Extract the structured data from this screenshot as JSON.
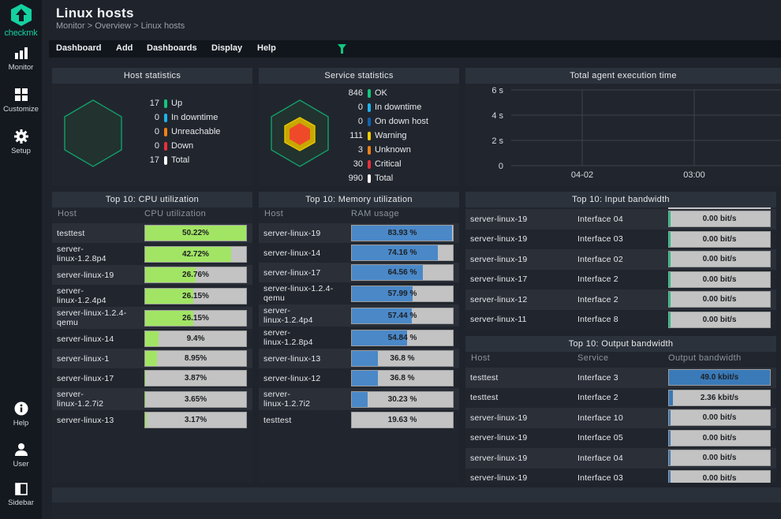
{
  "app": {
    "brand": "checkmk",
    "page_title": "Linux hosts",
    "breadcrumb": "Monitor > Overview > Linux hosts",
    "accent_color": "#15d1a0"
  },
  "sidebar": {
    "top_items": [
      {
        "label": "Monitor",
        "icon": "bar-chart-icon"
      },
      {
        "label": "Customize",
        "icon": "grid-icon"
      },
      {
        "label": "Setup",
        "icon": "gear-icon"
      }
    ],
    "bottom_items": [
      {
        "label": "Help",
        "icon": "info-icon"
      },
      {
        "label": "User",
        "icon": "user-icon"
      },
      {
        "label": "Sidebar",
        "icon": "sidebar-icon"
      }
    ]
  },
  "menubar": {
    "items": [
      "Dashboard",
      "Add",
      "Dashboards",
      "Display",
      "Help"
    ],
    "filter_icon": "filter-icon"
  },
  "host_stats": {
    "title": "Host statistics",
    "rows": [
      {
        "count": "17",
        "label": "Up",
        "color": "#13c77e"
      },
      {
        "count": "0",
        "label": "In downtime",
        "color": "#1fb3ec"
      },
      {
        "count": "0",
        "label": "Unreachable",
        "color": "#f08018"
      },
      {
        "count": "0",
        "label": "Down",
        "color": "#e8303a"
      },
      {
        "count": "17",
        "label": "Total",
        "color": "#ffffff"
      }
    ]
  },
  "service_stats": {
    "title": "Service statistics",
    "rows": [
      {
        "count": "846",
        "label": "OK",
        "color": "#13c77e"
      },
      {
        "count": "0",
        "label": "In downtime",
        "color": "#1fb3ec"
      },
      {
        "count": "0",
        "label": "On down host",
        "color": "#1062b4"
      },
      {
        "count": "111",
        "label": "Warning",
        "color": "#f5cc00"
      },
      {
        "count": "3",
        "label": "Unknown",
        "color": "#f08018"
      },
      {
        "count": "30",
        "label": "Critical",
        "color": "#e8303a"
      },
      {
        "count": "990",
        "label": "Total",
        "color": "#ffffff"
      }
    ]
  },
  "chart_data": {
    "type": "line",
    "title": "Total agent execution time",
    "xlabel": "",
    "ylabel": "",
    "y_ticks": [
      "0",
      "2 s",
      "4 s",
      "6 s"
    ],
    "y_tick_values": [
      0,
      2,
      4,
      6
    ],
    "ylim": [
      0,
      6
    ],
    "x_ticks": [
      "04-02",
      "03:00"
    ],
    "grid": true,
    "series": []
  },
  "cpu": {
    "title": "Top 10: CPU utilization",
    "headers": [
      "Host",
      "CPU utilization"
    ],
    "fill_color": "#a2e564",
    "rows": [
      {
        "host": "testtest",
        "value": "50.22%",
        "fraction": 1.0
      },
      {
        "host": "server-\nlinux-1.2.8p4",
        "value": "42.72%",
        "fraction": 0.85
      },
      {
        "host": "server-linux-19",
        "value": "26.76%",
        "fraction": 0.5
      },
      {
        "host": "server-\nlinux-1.2.4p4",
        "value": "26.15%",
        "fraction": 0.48
      },
      {
        "host": "server-linux-1.2.4-\nqemu",
        "value": "26.15%",
        "fraction": 0.48
      },
      {
        "host": "server-linux-14",
        "value": "9.4%",
        "fraction": 0.13
      },
      {
        "host": "server-linux-1",
        "value": "8.95%",
        "fraction": 0.12
      },
      {
        "host": "server-linux-17",
        "value": "3.87%",
        "fraction": 0.01
      },
      {
        "host": "server-\nlinux-1.2.7i2",
        "value": "3.65%",
        "fraction": 0.01
      },
      {
        "host": "server-linux-13",
        "value": "3.17%",
        "fraction": 0.005
      }
    ]
  },
  "memory": {
    "title": "Top 10: Memory utilization",
    "headers": [
      "Host",
      "RAM usage"
    ],
    "fill_color": "#4a88c8",
    "rows": [
      {
        "host": "server-linux-19",
        "value": "83.93 %",
        "fraction": 0.99
      },
      {
        "host": "server-linux-14",
        "value": "74.16 %",
        "fraction": 0.85
      },
      {
        "host": "server-linux-17",
        "value": "64.56 %",
        "fraction": 0.7
      },
      {
        "host": "server-linux-1.2.4-\nqemu",
        "value": "57.99 %",
        "fraction": 0.6
      },
      {
        "host": "server-\nlinux-1.2.4p4",
        "value": "57.44 %",
        "fraction": 0.59
      },
      {
        "host": "server-\nlinux-1.2.8p4",
        "value": "54.84 %",
        "fraction": 0.55
      },
      {
        "host": "server-linux-13",
        "value": "36.8 %",
        "fraction": 0.26
      },
      {
        "host": "server-linux-12",
        "value": "36.8 %",
        "fraction": 0.26
      },
      {
        "host": "server-\nlinux-1.2.7i2",
        "value": "30.23 %",
        "fraction": 0.16
      },
      {
        "host": "testtest",
        "value": "19.63 %",
        "fraction": 0.0
      }
    ]
  },
  "input_bw": {
    "title": "Top 10: Input bandwidth",
    "fill_color": "#13c77e",
    "rows": [
      {
        "host": "server-linux-19",
        "service": "Interface 04",
        "value": "0.00 bit/s",
        "fraction": 0.005
      },
      {
        "host": "server-linux-19",
        "service": "Interface 03",
        "value": "0.00 bit/s",
        "fraction": 0.005
      },
      {
        "host": "server-linux-19",
        "service": "Interface 02",
        "value": "0.00 bit/s",
        "fraction": 0.005
      },
      {
        "host": "server-linux-17",
        "service": "Interface 2",
        "value": "0.00 bit/s",
        "fraction": 0.005
      },
      {
        "host": "server-linux-12",
        "service": "Interface 2",
        "value": "0.00 bit/s",
        "fraction": 0.005
      },
      {
        "host": "server-linux-11",
        "service": "Interface 8",
        "value": "0.00 bit/s",
        "fraction": 0.005
      }
    ]
  },
  "output_bw": {
    "title": "Top 10: Output bandwidth",
    "headers": [
      "Host",
      "Service",
      "Output bandwidth"
    ],
    "fill_color": "#3a7ab8",
    "rows": [
      {
        "host": "testtest",
        "service": "Interface 3",
        "value": "49.0 kbit/s",
        "fraction": 1.0
      },
      {
        "host": "testtest",
        "service": "Interface 2",
        "value": "2.36 kbit/s",
        "fraction": 0.04
      },
      {
        "host": "server-linux-19",
        "service": "Interface 10",
        "value": "0.00 bit/s",
        "fraction": 0.005
      },
      {
        "host": "server-linux-19",
        "service": "Interface 05",
        "value": "0.00 bit/s",
        "fraction": 0.005
      },
      {
        "host": "server-linux-19",
        "service": "Interface 04",
        "value": "0.00 bit/s",
        "fraction": 0.005
      },
      {
        "host": "server-linux-19",
        "service": "Interface 03",
        "value": "0.00 bit/s",
        "fraction": 0.005
      }
    ]
  }
}
